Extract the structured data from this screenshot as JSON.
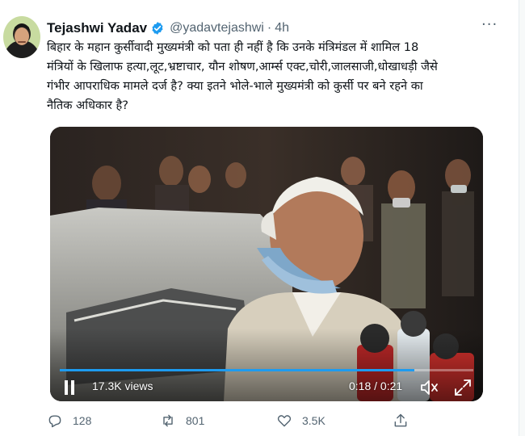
{
  "tweet": {
    "author": {
      "display_name": "Tejashwi Yadav",
      "handle": "@yadavtejashwi",
      "verified": true
    },
    "separator": "·",
    "time": "4h",
    "more_label": "···",
    "text_lines": [
      "बिहार के महान कुर्सीवादी मुख्यमंत्री को पता ही नहीं है कि उनके मंत्रिमंडल में शामिल 18",
      "मंत्रियों के खिलाफ हत्या,लूट,भ्रष्टाचार, यौन शोषण,आर्म्स एक्ट,चोरी,जालसाजी,धोखाधड़ी जैसे",
      "गंभीर आपराधिक मामले दर्ज है? क्या इतने भोले-भाले मुख्यमंत्री को कुर्सी पर बने रहने का",
      "नैतिक अधिकार है?"
    ],
    "video": {
      "views": "17.3K views",
      "timecode": "0:18 / 0:21",
      "progress": 0.857,
      "state": "paused-control-visible",
      "icons": [
        "pause-icon",
        "mute-icon",
        "fullscreen-icon"
      ]
    },
    "actions": {
      "replies": "128",
      "retweets": "801",
      "likes": "3.5K"
    },
    "colors": {
      "accent": "#1d9bf0",
      "text": "#0f1419",
      "secondary": "#536471"
    }
  }
}
